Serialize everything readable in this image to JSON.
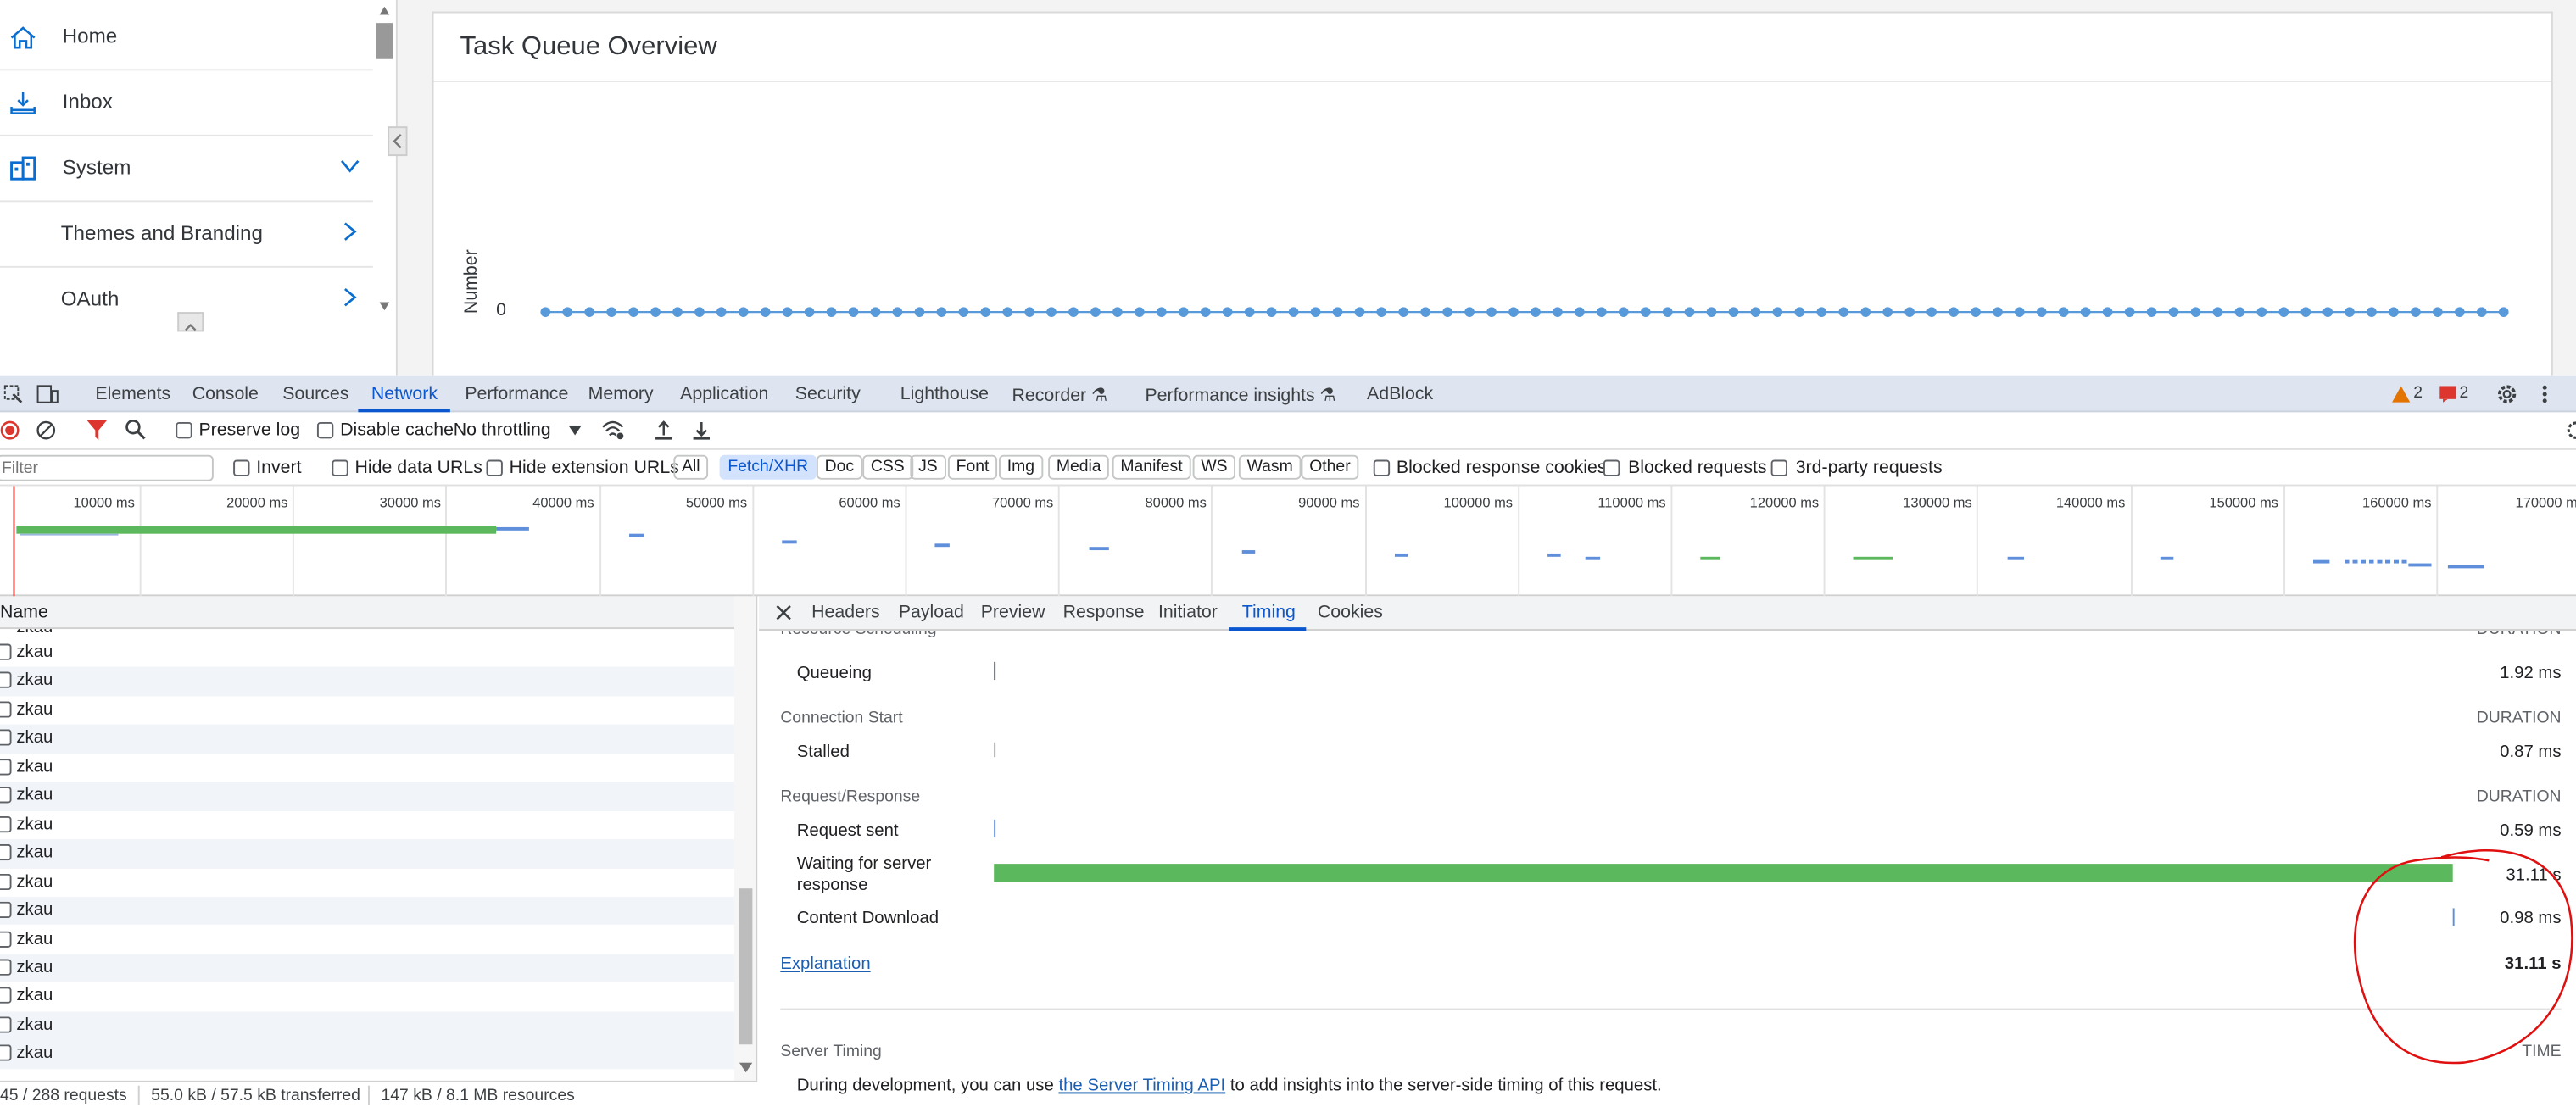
{
  "sidebar": {
    "items": [
      {
        "label": "Home",
        "icon": "home-icon"
      },
      {
        "label": "Inbox",
        "icon": "inbox-icon"
      },
      {
        "label": "System",
        "icon": "system-icon"
      },
      {
        "label": "Themes and Branding"
      },
      {
        "label": "OAuth"
      }
    ]
  },
  "card": {
    "title": "Task Queue Overview",
    "ylabel": "Number",
    "ytick": "0",
    "accent": "#5899da"
  },
  "chart_data": {
    "type": "line",
    "title": "Task Queue Overview",
    "ylabel": "Number",
    "xlabel": "",
    "y_tick_labels": [
      "0"
    ],
    "series": [
      {
        "values": [
          0,
          0,
          0,
          0,
          0,
          0,
          0,
          0,
          0,
          0,
          0,
          0,
          0,
          0,
          0,
          0,
          0,
          0,
          0,
          0,
          0,
          0,
          0,
          0,
          0,
          0,
          0,
          0,
          0,
          0,
          0,
          0,
          0,
          0,
          0,
          0,
          0,
          0,
          0,
          0,
          0,
          0,
          0,
          0,
          0,
          0,
          0,
          0,
          0,
          0,
          0,
          0,
          0,
          0,
          0,
          0,
          0,
          0,
          0,
          0,
          0,
          0,
          0,
          0,
          0,
          0,
          0,
          0,
          0,
          0,
          0,
          0,
          0,
          0,
          0,
          0,
          0,
          0,
          0,
          0,
          0,
          0,
          0,
          0,
          0,
          0,
          0,
          0,
          0,
          0
        ]
      }
    ],
    "grid": false
  },
  "devtools": {
    "tabs": [
      "Elements",
      "Console",
      "Sources",
      "Network",
      "Performance",
      "Memory",
      "Application",
      "Security",
      "Lighthouse",
      "Recorder ⚗",
      "Performance insights ⚗",
      "AdBlock"
    ],
    "selected_tab": "Network",
    "warnings": "2",
    "errors": "2",
    "toolbar": {
      "preserve_log": "Preserve log",
      "disable_cache": "Disable cache",
      "throttling": "No throttling"
    },
    "filter": {
      "placeholder": "Filter",
      "invert": "Invert",
      "hide_data_urls": "Hide data URLs",
      "hide_extension_urls": "Hide extension URLs",
      "types": [
        "All",
        "Fetch/XHR",
        "Doc",
        "CSS",
        "JS",
        "Font",
        "Img",
        "Media",
        "Manifest",
        "WS",
        "Wasm",
        "Other"
      ],
      "selected_type": "Fetch/XHR",
      "blocked_response_cookies": "Blocked response cookies",
      "blocked_requests": "Blocked requests",
      "third_party": "3rd-party requests"
    },
    "overview_ticks": [
      "10000 ms",
      "20000 ms",
      "30000 ms",
      "40000 ms",
      "50000 ms",
      "60000 ms",
      "70000 ms",
      "80000 ms",
      "90000 ms",
      "100000 ms",
      "110000 ms",
      "120000 ms",
      "130000 ms",
      "140000 ms",
      "150000 ms",
      "160000 ms",
      "170000 ms"
    ],
    "requests": {
      "header": "Name",
      "rows": [
        "zkau",
        "zkau",
        "zkau",
        "zkau",
        "zkau",
        "zkau",
        "zkau",
        "zkau",
        "zkau",
        "zkau",
        "zkau",
        "zkau",
        "zkau",
        "zkau",
        "zkau"
      ]
    },
    "status": {
      "requests": "45 / 288 requests",
      "transferred": "55.0 kB / 57.5 kB transferred",
      "resources": "147 kB / 8.1 MB resources"
    },
    "detail_tabs": [
      "Headers",
      "Payload",
      "Preview",
      "Response",
      "Initiator",
      "Timing",
      "Cookies"
    ],
    "selected_detail_tab": "Timing",
    "timing": {
      "resource_scheduling": "Resource Scheduling",
      "duration": "DURATION",
      "queueing": {
        "label": "Queueing",
        "value": "1.92 ms"
      },
      "connection_start": "Connection Start",
      "stalled": {
        "label": "Stalled",
        "value": "0.87 ms"
      },
      "request_response": "Request/Response",
      "request_sent": {
        "label": "Request sent",
        "value": "0.59 ms"
      },
      "waiting_line1": "Waiting for server",
      "waiting_line2": "response",
      "waiting_value": "31.11 s",
      "content_download": {
        "label": "Content Download",
        "value": "0.98 ms"
      },
      "explanation": "Explanation",
      "total": "31.11 s",
      "server_timing": "Server Timing",
      "time": "TIME",
      "dev_note_pre": "During development, you can use ",
      "dev_note_link": "the Server Timing API",
      "dev_note_post": " to add insights into the server-side timing of this request.",
      "wait_color": "#5cb85c"
    }
  }
}
